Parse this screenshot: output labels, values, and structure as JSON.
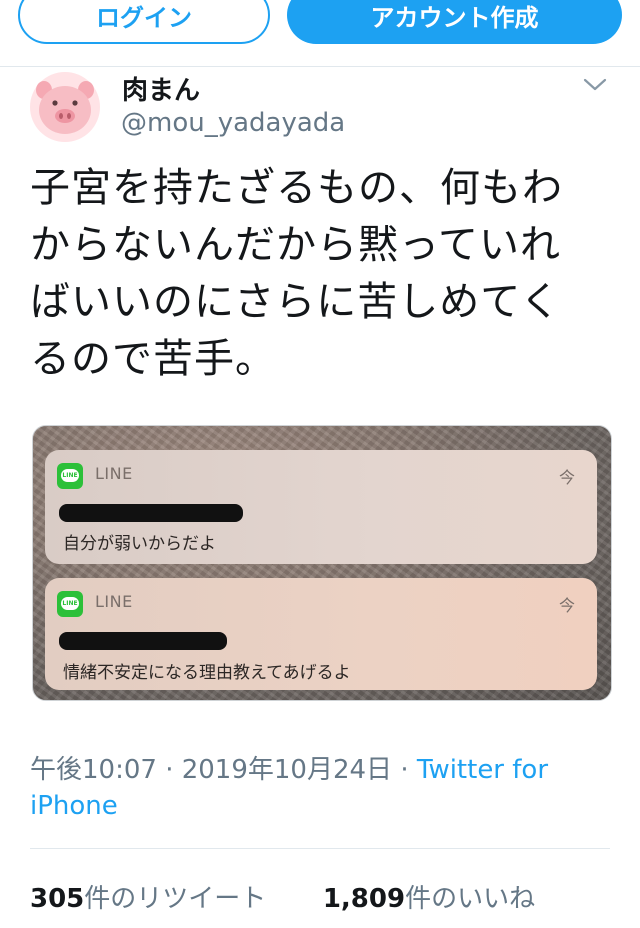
{
  "header": {
    "login_label": "ログイン",
    "signup_label": "アカウント作成",
    "accent_color": "#1da1f2"
  },
  "tweet": {
    "author_name": "肉まん",
    "author_handle": "@mou_yadayada",
    "avatar_icon": "pig-face-icon",
    "menu_icon": "chevron-down-icon",
    "text_lines": [
      "子宮を持たざるもの、何もわ",
      "からないんだから黙っていれ",
      "ばいいのにさらに苦しめてく",
      "るので苦手。"
    ],
    "timestamp": "午後10:07 · 2019年10月24日 · ",
    "client_label": "Twitter for iPhone",
    "retweet_count": "305",
    "retweet_label": "件のリツイート",
    "like_count": "1,809",
    "like_label": "件のいいね"
  },
  "photo": {
    "notifications": [
      {
        "app": "LINE",
        "time": "今",
        "message": "自分が弱いからだよ",
        "icon": "line-app-icon"
      },
      {
        "app": "LINE",
        "time": "今",
        "message": "情緒不安定になる理由教えてあげるよ",
        "icon": "line-app-icon"
      }
    ]
  }
}
